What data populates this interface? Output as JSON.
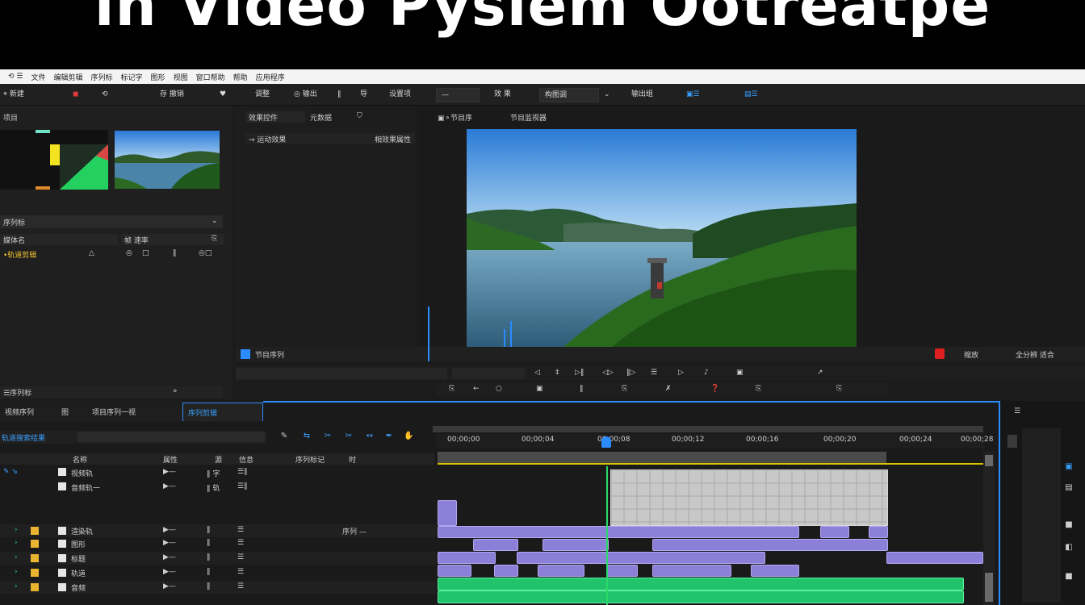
{
  "banner": {
    "title": "in Video Pysiem Ootreatpe"
  },
  "menubar": {
    "items": [
      "⟲ ☰",
      "文件",
      "编辑剪辑",
      "序列标",
      "标记字",
      "图形",
      "视图",
      "窗口帮助",
      "帮助",
      "应用程序"
    ]
  },
  "toolbar": {
    "items": [
      "⌖ 新建",
      "◼",
      "⟲",
      "存 撤销",
      "♥",
      "调整",
      "◎ 输出",
      "‖",
      "导",
      "设置项",
      "—",
      "效 果",
      "构图调",
      "⌄",
      "输出组",
      "▣☰",
      "▤☰"
    ]
  },
  "project": {
    "header_label": "项目",
    "dropdown_label": "序列标",
    "columns": [
      "媒体名",
      "帧 速率",
      "⎘"
    ],
    "row_label": "•轨道剪辑",
    "row_values": [
      "△",
      "◎",
      "□",
      "‖",
      "◎□"
    ],
    "footer_label": "☰序列标",
    "footer_value": "»"
  },
  "effects": {
    "tab_label": "效果控件",
    "tab2_label": "元数据",
    "tab3_label": "⛉",
    "sub_label": "→ 运动效果",
    "sub_value": "相效果属性"
  },
  "program_monitor": {
    "header_left": "▣⚬节目序",
    "header_right": "节目监视器",
    "bottom_left": "节目序列",
    "bottom_right_a": "缩放",
    "bottom_right_b": "全分辨 适合",
    "transport": [
      "◁",
      "‡",
      "▷‖",
      "◁▷",
      "‖▷",
      "☰",
      "▷",
      "♪",
      "▣",
      "↗"
    ],
    "controls_row": [
      "⎘",
      "←",
      "○",
      "▣",
      "‖",
      "⎘",
      "✗",
      "❓",
      "⎘",
      "⎘",
      "⎘",
      "⎘",
      "⎘"
    ]
  },
  "timeline": {
    "tabs": [
      "视频序列",
      "图",
      "项目序列一视"
    ],
    "sequence_tab": "序列剪辑",
    "search_placeholder": "轨道搜索结果",
    "col_headers": [
      "名称",
      "属性",
      "源",
      "信息",
      "序列标记",
      "时"
    ],
    "ruler_times": [
      "00;00;00",
      "00;00;04",
      "00;00;08",
      "00;00;12",
      "00;00;16",
      "00;00;20",
      "00;00;24",
      "00;00;28"
    ],
    "tracks": [
      {
        "name": "视频轨",
        "v1": "▶—",
        "v2": "‖ 字",
        "v3": "☰‖",
        "color": "#2e7dd4"
      },
      {
        "name": "音频轨一",
        "v1": "▶—",
        "v2": "‖ 轨",
        "v3": "☰‖",
        "color": "#2e7dd4"
      },
      {
        "name": "渲染轨",
        "v1": "▶—",
        "v2": "‖",
        "v3": "☰",
        "color": "#e9b430"
      },
      {
        "name": "图形",
        "v1": "▶—",
        "v2": "‖",
        "v3": "☰",
        "color": "#e9b430"
      },
      {
        "name": "标题",
        "v1": "▶—",
        "v2": "‖",
        "v3": "☰",
        "color": "#e9b430"
      },
      {
        "name": "轨道",
        "v1": "▶—",
        "v2": "‖",
        "v3": "☰",
        "color": "#e9b430"
      },
      {
        "name": "音频",
        "v1": "▶—",
        "v2": "‖",
        "v3": "☰",
        "color": "#e9b430"
      }
    ],
    "track_extra": "序列 —"
  },
  "right_strip": {
    "label": "☰"
  },
  "colors": {
    "accent": "#2a8cff",
    "playhead": "#2bd96a",
    "video_clip": "#8b7fd8",
    "audio_clip": "#21c36b",
    "marker_bar": "#d7c400"
  }
}
